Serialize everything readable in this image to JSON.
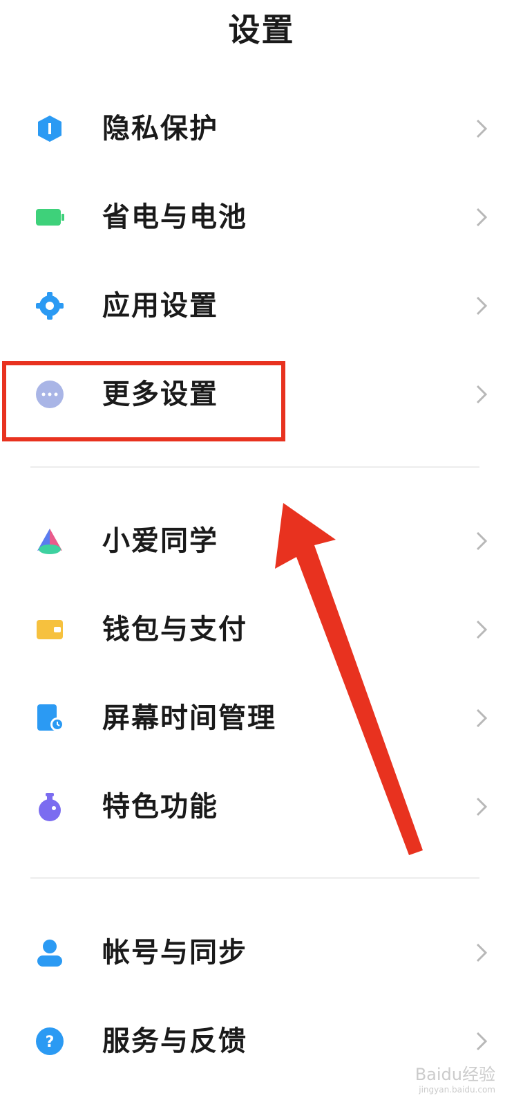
{
  "header": {
    "title": "设置"
  },
  "groups": [
    {
      "items": [
        {
          "label": "隐私保护",
          "icon": "shield-icon",
          "color": "#2b9af3"
        },
        {
          "label": "省电与电池",
          "icon": "battery-icon",
          "color": "#3ed17a"
        },
        {
          "label": "应用设置",
          "icon": "gear-icon",
          "color": "#2b9af3"
        },
        {
          "label": "更多设置",
          "icon": "more-dots-icon",
          "color": "#a9b5e6"
        }
      ]
    },
    {
      "items": [
        {
          "label": "小爱同学",
          "icon": "xiaoai-icon",
          "color": "#e95b8b"
        },
        {
          "label": "钱包与支付",
          "icon": "wallet-icon",
          "color": "#f6c13e"
        },
        {
          "label": "屏幕时间管理",
          "icon": "screen-time-icon",
          "color": "#2b9af3"
        },
        {
          "label": "特色功能",
          "icon": "potion-icon",
          "color": "#7b6cf0"
        }
      ]
    },
    {
      "items": [
        {
          "label": "帐号与同步",
          "icon": "account-icon",
          "color": "#2b9af3"
        },
        {
          "label": "服务与反馈",
          "icon": "help-icon",
          "color": "#2b9af3"
        }
      ]
    }
  ],
  "annotation": {
    "highlight_color": "#e8321f"
  },
  "watermark": {
    "text": "Baidu经验",
    "sub": "jingyan.baidu.com"
  }
}
